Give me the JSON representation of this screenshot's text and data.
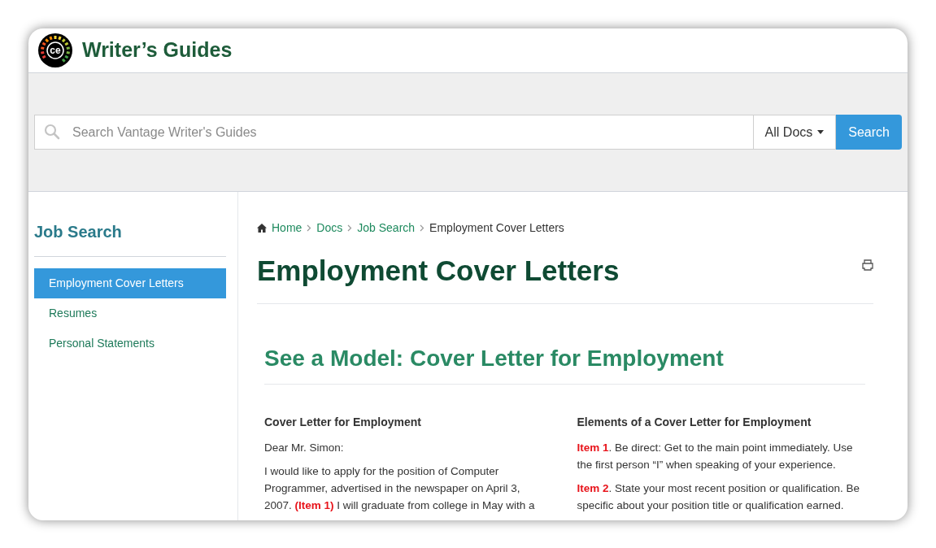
{
  "site": {
    "title": "Writer’s Guides",
    "logo_text": "ce"
  },
  "search": {
    "placeholder": "Search Vantage Writer's Guides",
    "scope": "All Docs",
    "button": "Search"
  },
  "sidebar": {
    "title": "Job Search",
    "items": [
      {
        "label": "Employment Cover Letters",
        "selected": true
      },
      {
        "label": "Resumes",
        "selected": false
      },
      {
        "label": "Personal Statements",
        "selected": false
      }
    ]
  },
  "breadcrumb": [
    {
      "label": "Home",
      "kind": "link"
    },
    {
      "label": "Docs",
      "kind": "link"
    },
    {
      "label": "Job Search",
      "kind": "link"
    },
    {
      "label": "Employment Cover Letters",
      "kind": "current"
    }
  ],
  "page_title": "Employment Cover Letters",
  "section_title": "See a Model: Cover Letter for Employment",
  "columns": [
    {
      "heading": "Cover Letter for Employment",
      "paragraphs": [
        [
          {
            "kind": "plain",
            "text": "Dear Mr. Simon:"
          }
        ],
        [
          {
            "kind": "plain",
            "text": "I would like to apply for the position of Computer Programmer, advertised in the newspaper on April 3, 2007. "
          },
          {
            "kind": "item",
            "text": "(Item 1)"
          },
          {
            "kind": "plain",
            "text": " I will graduate from college in May with a"
          }
        ]
      ]
    },
    {
      "heading": "Elements of a Cover Letter for Employment",
      "paragraphs": [
        [
          {
            "kind": "item",
            "text": "Item 1"
          },
          {
            "kind": "plain",
            "text": ". Be direct: Get to the main point immediately. Use the first person “I” when speaking of your experience."
          }
        ],
        [
          {
            "kind": "item",
            "text": "Item 2"
          },
          {
            "kind": "plain",
            "text": ". State your most recent position or qualification. Be specific about your position title or qualification earned."
          }
        ]
      ]
    }
  ]
}
